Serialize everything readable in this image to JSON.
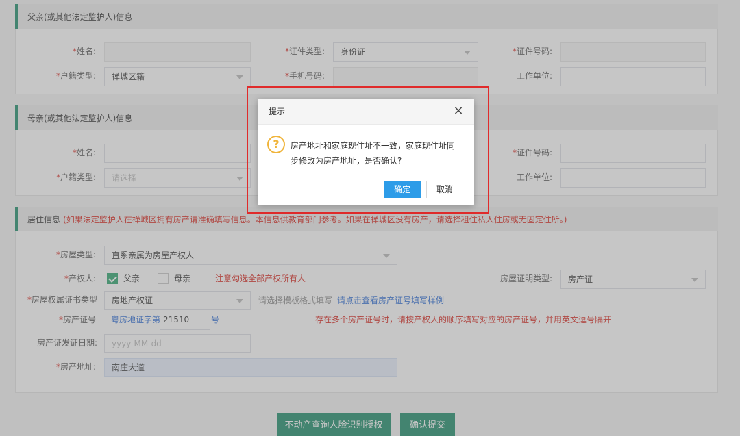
{
  "father": {
    "header": "父亲(或其他法定监护人)信息",
    "name_label": "姓名:",
    "id_type_label": "证件类型:",
    "id_type_value": "身份证",
    "id_number_label": "证件号码:",
    "hukou_label": "户籍类型:",
    "hukou_value": "禅城区籍",
    "phone_label": "手机号码:",
    "work_label": "工作单位:"
  },
  "mother": {
    "header": "母亲(或其他法定监护人)信息",
    "name_label": "姓名:",
    "id_number_label": "证件号码:",
    "hukou_label": "户籍类型:",
    "hukou_placeholder": "请选择",
    "work_label": "工作单位:"
  },
  "residence": {
    "header": "居住信息",
    "note": "(如果法定监护人在禅城区拥有房产请准确填写信息。本信息供教育部门参考。如果在禅城区没有房产，请选择租住私人住房或无固定住所。)",
    "house_type_label": "房屋类型:",
    "house_type_value": "直系亲属为房屋产权人",
    "owner_label": "产权人:",
    "owner_father": "父亲",
    "owner_mother": "母亲",
    "owner_father_checked": true,
    "owner_mother_checked": false,
    "owner_note": "注意勾选全部产权所有人",
    "proof_type_label": "房屋证明类型:",
    "proof_type_value": "房产证",
    "cert_type_label": "房屋权属证书类型",
    "cert_type_value": "房地产权证",
    "cert_hint": "请选择模板格式填写",
    "cert_link": "请点击查看房产证号填写样例",
    "cert_number_label": "房产证号",
    "cert_prefix": "粤房地证字第",
    "cert_number_value": "21510",
    "cert_suffix": "号",
    "cert_multi_note": "存在多个房产证号时，请按产权人的顺序填写对应的房产证号，并用英文逗号隔开",
    "issue_date_label": "房产证发证日期:",
    "issue_date_placeholder": "yyyy-MM-dd",
    "address_label": "房产地址:",
    "address_value": "南庄大道"
  },
  "actions": {
    "face_auth": "不动产查询人脸识别授权",
    "submit": "确认提交"
  },
  "dialog": {
    "title": "提示",
    "close": "×",
    "icon": "?",
    "message": "房产地址和家庭现住址不一致，家庭现住址同步修改为房产地址，是否确认?",
    "ok": "确定",
    "cancel": "取消"
  },
  "required_mark": "*",
  "colors": {
    "accent_green": "#1e8e6b",
    "required_red": "#d9251d",
    "link_blue": "#2b6cd6",
    "dialog_primary": "#2d9ce8",
    "warning_yellow": "#f0b43a",
    "highlight_border": "#e02b2b"
  }
}
